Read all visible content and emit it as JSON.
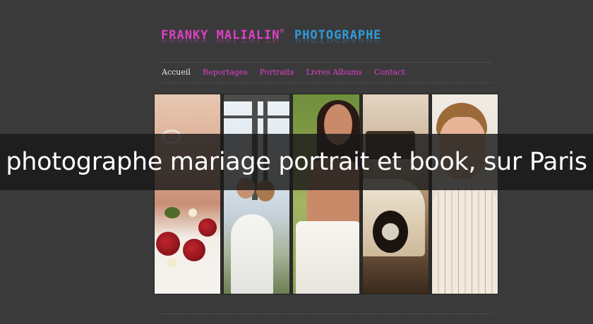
{
  "header": {
    "brand_name": "FRANKY MALIALIN",
    "brand_sep": "®",
    "brand_role": "PHOTOGRAPHE"
  },
  "nav": {
    "items": [
      {
        "label": "Accueil",
        "active": true
      },
      {
        "label": "Reportages",
        "active": false
      },
      {
        "label": "Portraits",
        "active": false
      },
      {
        "label": "Livres Albums",
        "active": false
      },
      {
        "label": "Contact",
        "active": false
      }
    ]
  },
  "banner": {
    "text": "photographe mariage portrait et book, sur Paris"
  },
  "colors": {
    "background": "#3a3a3a",
    "brand_pink": "#e040c8",
    "brand_blue": "#2f9be0",
    "nav_active": "#e6e6e6",
    "banner_bg": "#181818"
  }
}
